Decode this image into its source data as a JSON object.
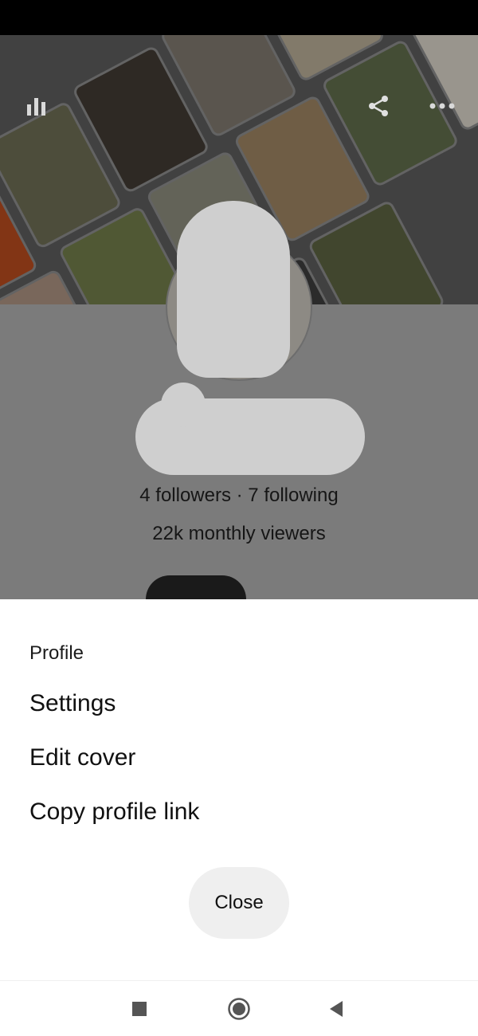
{
  "app": {
    "icons": {
      "analytics": "bar-chart-icon",
      "share": "share-icon",
      "more": "more-options-icon"
    }
  },
  "profile": {
    "stats": "4 followers · 7 following",
    "monthly_viewers": "22k monthly viewers"
  },
  "sheet": {
    "title": "Profile",
    "items": [
      {
        "label": "Settings"
      },
      {
        "label": "Edit cover"
      },
      {
        "label": "Copy profile link"
      }
    ],
    "close_label": "Close"
  },
  "nav": {
    "recents": "square-icon",
    "home": "circle-icon",
    "back": "triangle-back-icon"
  },
  "colors": {
    "overlay_gray": "#7b7b7b",
    "sheet_bg": "#ffffff",
    "close_bg": "#efefef",
    "text": "#111111"
  }
}
